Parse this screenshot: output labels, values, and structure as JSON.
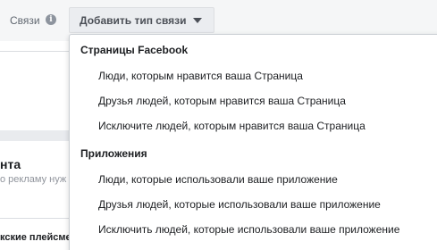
{
  "header": {
    "connections_label": "Связи",
    "info_icon": "i",
    "add_type_label": "Добавить тип связи"
  },
  "background": {
    "heading": "нта",
    "subtext": "о рекламу нуж",
    "placements": "кские плейсме"
  },
  "menu": {
    "sections": [
      {
        "title": "Страницы Facebook",
        "items": [
          "Люди, которым нравится ваша Страница",
          "Друзья людей, которым нравится ваша Страница",
          "Исключите людей, которым нравится ваша Страница"
        ]
      },
      {
        "title": "Приложения",
        "items": [
          "Люди, которые использовали ваше приложение",
          "Друзья людей, которые использовали ваше приложение",
          "Исключить людей, которые использовали ваше приложение"
        ]
      }
    ]
  },
  "colors": {
    "text": "#1c1e21",
    "muted": "#606770",
    "button_bg": "#ebedf0",
    "border": "#ccd0d5"
  }
}
